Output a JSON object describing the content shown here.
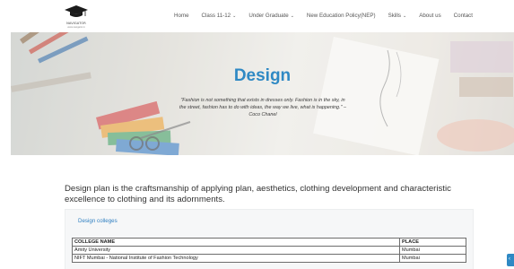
{
  "header": {
    "logo_text": "NAVIGATOR",
    "logo_sub": "www.navigator.in",
    "nav": [
      {
        "label": "Home",
        "dropdown": false
      },
      {
        "label": "Class 11-12",
        "dropdown": true
      },
      {
        "label": "Under Graduate",
        "dropdown": true
      },
      {
        "label": "New Education Policy(NEP)",
        "dropdown": false
      },
      {
        "label": "Skills",
        "dropdown": true
      },
      {
        "label": "About us",
        "dropdown": false
      },
      {
        "label": "Contact",
        "dropdown": false
      }
    ]
  },
  "hero": {
    "title": "Design",
    "quote": "\"Fashion is not something that exists in dresses only. Fashion is in the sky, in the street, fashion has to do with ideas, the way we live, what is happening.\" – Coco Chanel"
  },
  "intro": "Design plan is the craftsmanship of applying plan, aesthetics, clothing development and characteristic excellence to clothing and its adornments.",
  "card": {
    "tab_label": "Design colleges",
    "table": {
      "headers": [
        "COLLEGE NAME",
        "PLACE"
      ],
      "rows": [
        [
          "Amity University",
          "Mumbai"
        ],
        [
          "NIFT Mumbai - National Institute of Fashion Technology",
          "Mumbai"
        ]
      ]
    }
  },
  "colors": {
    "accent": "#2f89c4",
    "link": "#2f7fc1",
    "text": "#333333"
  }
}
